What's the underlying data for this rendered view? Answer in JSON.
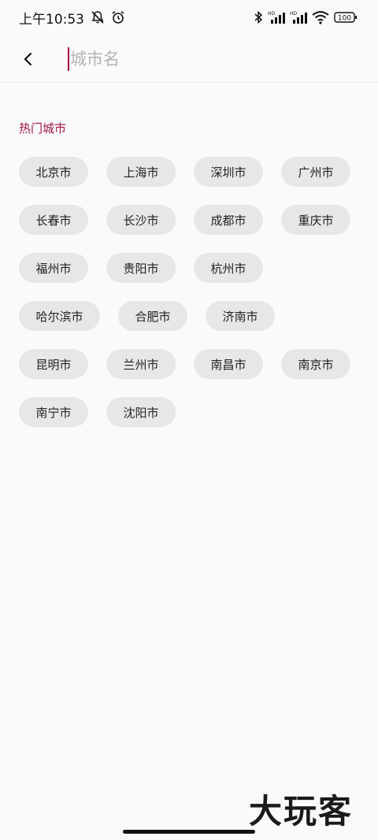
{
  "status_bar": {
    "time": "上午10:53",
    "battery": "100",
    "icons": [
      "mute-bell-icon",
      "alarm-icon",
      "bluetooth-icon",
      "hd-signal-icon",
      "hd-signal-icon",
      "wifi-icon",
      "battery-icon"
    ]
  },
  "top_bar": {
    "back_icon": "chevron-left-icon",
    "search_placeholder": "城市名",
    "accent_color": "#a0163f"
  },
  "hot_cities": {
    "title": "热门城市",
    "cities": [
      "北京市",
      "上海市",
      "深圳市",
      "广州市",
      "长春市",
      "长沙市",
      "成都市",
      "重庆市",
      "福州市",
      "贵阳市",
      "杭州市",
      "哈尔滨市",
      "合肥市",
      "济南市",
      "昆明市",
      "兰州市",
      "南昌市",
      "南京市",
      "南宁市",
      "沈阳市"
    ]
  },
  "watermark": "大玩客"
}
